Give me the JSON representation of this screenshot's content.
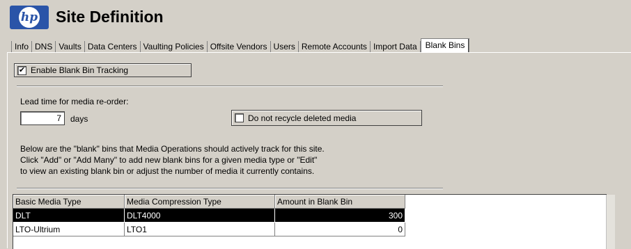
{
  "header": {
    "logo_text": "hp",
    "title": "Site Definition"
  },
  "tabs": [
    {
      "label": "Info"
    },
    {
      "label": "DNS"
    },
    {
      "label": "Vaults"
    },
    {
      "label": "Data Centers"
    },
    {
      "label": "Vaulting Policies"
    },
    {
      "label": "Offsite Vendors"
    },
    {
      "label": "Users"
    },
    {
      "label": "Remote Accounts"
    },
    {
      "label": "Import Data"
    },
    {
      "label": "Blank Bins"
    }
  ],
  "active_tab": "Blank Bins",
  "form": {
    "enable_tracking_label": "Enable Blank Bin Tracking",
    "enable_tracking_checked": true,
    "lead_time_label": "Lead time for media re-order:",
    "lead_time_value": "7",
    "days_label": "days",
    "no_recycle_label": "Do not recycle deleted media",
    "no_recycle_checked": false,
    "description_lines": [
      "Below are the \"blank\" bins that Media Operations should actively track for this site.",
      "Click \"Add\" or \"Add Many\" to add new blank bins for a given media type or \"Edit\"",
      "to view an existing blank bin or adjust the number of media it currently contains."
    ]
  },
  "table": {
    "columns": [
      "Basic Media Type",
      "Media Compression Type",
      "Amount in Blank Bin"
    ],
    "rows": [
      {
        "media_type": "DLT",
        "compression": "DLT4000",
        "amount": "300",
        "selected": true
      },
      {
        "media_type": "LTO-Ultrium",
        "compression": "LTO1",
        "amount": "0",
        "selected": false
      }
    ]
  }
}
